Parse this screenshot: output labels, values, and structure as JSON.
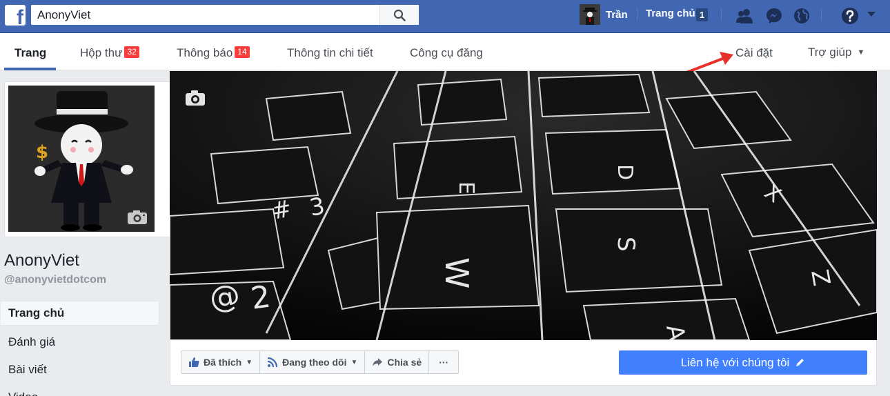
{
  "topbar": {
    "search_value": "AnonyViet",
    "user_name": "Trần",
    "home_label": "Trang chủ",
    "home_badge": "1"
  },
  "tabs": [
    {
      "label": "Trang",
      "badge": ""
    },
    {
      "label": "Hộp thư",
      "badge": "32"
    },
    {
      "label": "Thông báo",
      "badge": "14"
    },
    {
      "label": "Thông tin chi tiết",
      "badge": ""
    },
    {
      "label": "Công cụ đăng",
      "badge": ""
    },
    {
      "label": "Cài đặt",
      "badge": ""
    },
    {
      "label": "Trợ giúp",
      "badge": ""
    }
  ],
  "page": {
    "name": "AnonyViet",
    "handle": "@anonyvietdotcom"
  },
  "sidebar": {
    "items": [
      {
        "label": "Trang chủ"
      },
      {
        "label": "Đánh giá"
      },
      {
        "label": "Bài viết"
      },
      {
        "label": "Video"
      }
    ]
  },
  "actions": {
    "liked": "Đã thích",
    "following": "Đang theo dõi",
    "share": "Chia sẻ",
    "more": "···",
    "contact": "Liên hệ với chúng tôi"
  },
  "colors": {
    "brand_blue": "#4267b2",
    "cta_blue": "#4080ff",
    "badge_red": "#fa3e3e",
    "annotation_arrow": "#e8302a"
  }
}
